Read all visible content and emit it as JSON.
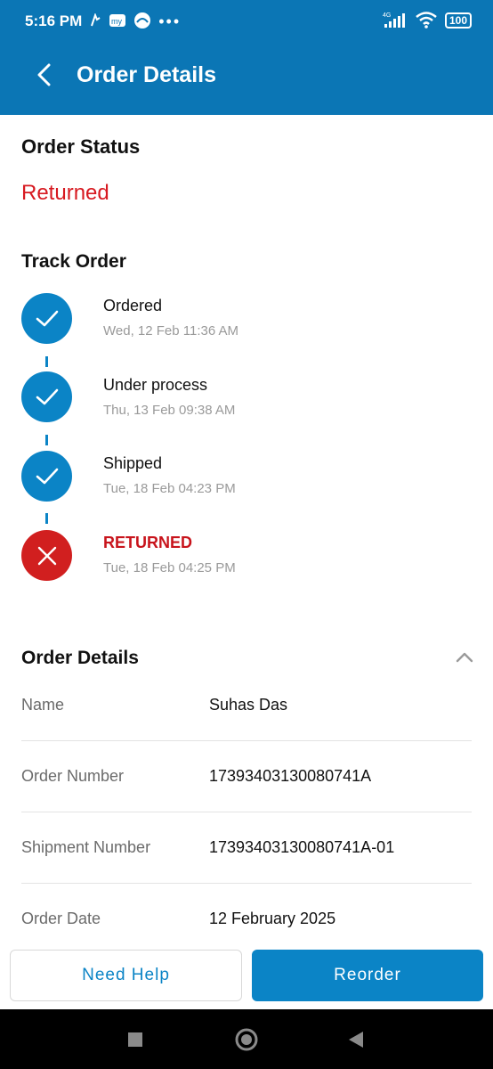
{
  "status_bar": {
    "time": "5:16 PM",
    "network": "4G",
    "battery": "100"
  },
  "app_bar": {
    "title": "Order Details"
  },
  "order_status": {
    "heading": "Order Status",
    "value": "Returned"
  },
  "track_order": {
    "heading": "Track Order",
    "steps": [
      {
        "label": "Ordered",
        "date": "Wed, 12 Feb 11:36 AM",
        "state": "done"
      },
      {
        "label": "Under process",
        "date": "Thu, 13 Feb 09:38 AM",
        "state": "done"
      },
      {
        "label": "Shipped",
        "date": "Tue, 18 Feb 04:23 PM",
        "state": "done"
      },
      {
        "label": "RETURNED",
        "date": "Tue, 18 Feb 04:25 PM",
        "state": "failed"
      }
    ]
  },
  "order_details": {
    "heading": "Order Details",
    "rows": [
      {
        "key": "Name",
        "value": "Suhas Das"
      },
      {
        "key": "Order Number",
        "value": "17393403130080741A"
      },
      {
        "key": "Shipment Number",
        "value": "17393403130080741A-01"
      },
      {
        "key": "Order Date",
        "value": "12 February 2025"
      }
    ]
  },
  "actions": {
    "need_help": "Need Help",
    "reorder": "Reorder"
  },
  "colors": {
    "brand": "#0b76b5",
    "accent": "#0b84c6",
    "error": "#d11f1f"
  }
}
